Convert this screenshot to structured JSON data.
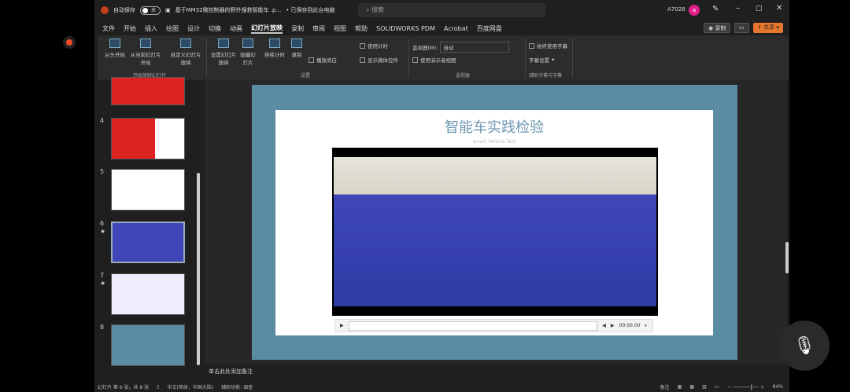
{
  "titlebar": {
    "autosave": "自动保存",
    "toggle": "关",
    "filename": "基于MM32微控制器的野外搜救智能车 .p...",
    "saved": "• 已保存到此台电脑",
    "search": "搜索",
    "user": "A7028",
    "avatar": "a"
  },
  "tabs": [
    "文件",
    "开始",
    "插入",
    "绘图",
    "设计",
    "切换",
    "动画",
    "幻灯片放映",
    "录制",
    "审阅",
    "视图",
    "帮助",
    "SOLIDWORKS PDM",
    "Acrobat",
    "百度网盘"
  ],
  "top_buttons": {
    "record": "录制",
    "share": "共享"
  },
  "ribbon": {
    "start": {
      "from_begin": "从头开始",
      "from_current": "从当前幻灯片开始",
      "custom": "自定义幻灯片放映",
      "group": "开始放映幻灯片"
    },
    "setup": {
      "setup": "设置幻灯片放映",
      "hide": "隐藏幻灯片",
      "rehearse": "排练计时",
      "record": "录制",
      "play_narration": "播放旁白",
      "use_timings": "使用计时",
      "show_media": "显示媒体控件",
      "group": "设置"
    },
    "monitors": {
      "monitor_label": "监视器(M):",
      "monitor_value": "自动",
      "presenter_view": "使用演示者视图",
      "group": "监视器"
    },
    "captions": {
      "always": "始终使用字幕",
      "settings": "字幕设置",
      "group": "辅助字幕与字幕"
    }
  },
  "thumbnails": [
    {
      "num": "4"
    },
    {
      "num": "5"
    },
    {
      "num": "6",
      "star": "★"
    },
    {
      "num": "7",
      "star": "★"
    },
    {
      "num": "8"
    }
  ],
  "slide": {
    "title": "智能车实践检验",
    "subtitle": "smart Vehicle Test",
    "time": "00:00.00"
  },
  "notes": "单击此处添加备注",
  "status": {
    "slide": "幻灯片 第 6 张，共 8 张",
    "lang": "中文(简体，中国大陆)",
    "access": "辅助功能: 调查",
    "notes": "备注",
    "zoom": "84%"
  }
}
